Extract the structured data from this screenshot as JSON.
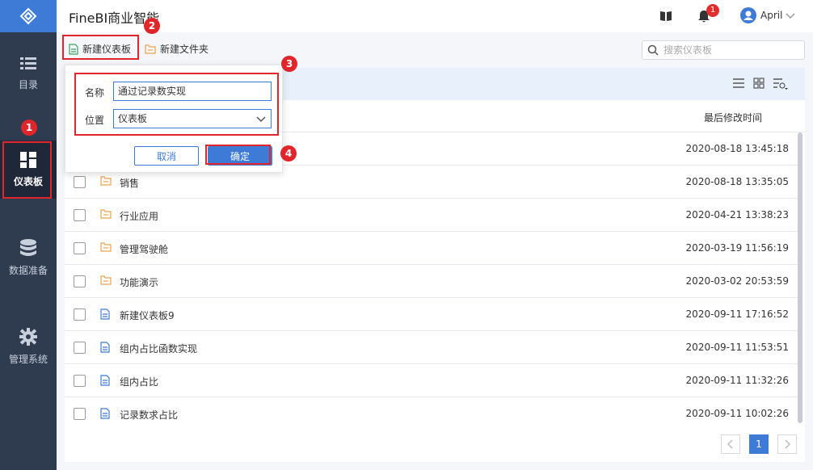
{
  "app": {
    "title": "FineBI商业智能"
  },
  "header": {
    "book_icon": "book-icon",
    "notification_count": "1",
    "user_name": "April"
  },
  "sidebar": {
    "items": [
      {
        "label": "目录",
        "icon": "list-icon"
      },
      {
        "label": "仪表板",
        "icon": "dashboard-icon"
      },
      {
        "label": "数据准备",
        "icon": "database-icon"
      },
      {
        "label": "管理系统",
        "icon": "gear-icon"
      }
    ]
  },
  "toolbar": {
    "new_dashboard": "新建仪表板",
    "new_folder": "新建文件夹",
    "search_placeholder": "搜索仪表板"
  },
  "table": {
    "col_time": "最后修改时间",
    "rows": [
      {
        "name": "",
        "time": "2020-08-18 13:45:18",
        "type": "folder"
      },
      {
        "name": "销售",
        "time": "2020-08-18 13:35:05",
        "type": "folder"
      },
      {
        "name": "行业应用",
        "time": "2020-04-21 13:38:23",
        "type": "folder"
      },
      {
        "name": "管理驾驶舱",
        "time": "2020-03-19 11:56:19",
        "type": "folder"
      },
      {
        "name": "功能演示",
        "time": "2020-03-02 20:53:59",
        "type": "folder"
      },
      {
        "name": "新建仪表板9",
        "time": "2020-09-11 17:16:52",
        "type": "doc"
      },
      {
        "name": "组内占比函数实现",
        "time": "2020-09-11 11:53:51",
        "type": "doc"
      },
      {
        "name": "组内占比",
        "time": "2020-09-11 11:32:26",
        "type": "doc"
      },
      {
        "name": "记录数求占比",
        "time": "2020-09-11 10:02:26",
        "type": "doc"
      }
    ]
  },
  "pagination": {
    "current": "1"
  },
  "dialog": {
    "name_label": "名称",
    "name_value": "通过记录数实现",
    "location_label": "位置",
    "location_value": "仪表板",
    "cancel": "取消",
    "ok": "确定"
  },
  "callouts": [
    "1",
    "2",
    "3",
    "4"
  ],
  "colors": {
    "sidebar": "#2f3b4f",
    "accent": "#3e7bd6",
    "highlight": "#e0262b",
    "folder": "#f0a04b"
  }
}
